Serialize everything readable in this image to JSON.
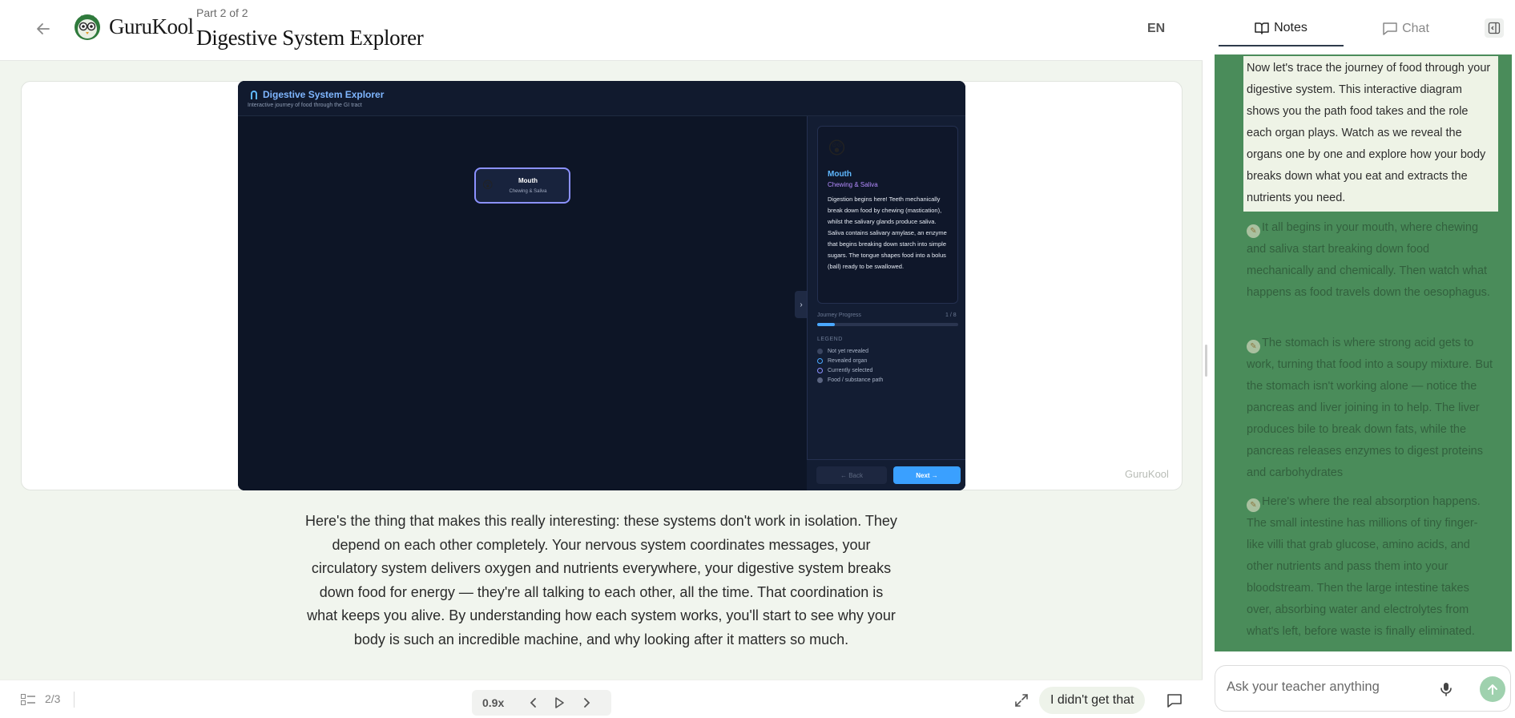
{
  "header": {
    "brand": "GuruKool",
    "part_label": "Part 2 of 2",
    "title": "Digestive System Explorer",
    "language": "EN"
  },
  "simulation": {
    "title": "Digestive System Explorer",
    "subtitle": "Interactive journey of food through the GI tract",
    "node": {
      "emoji": "😲",
      "name": "Mouth",
      "role": "Chewing & Saliva"
    },
    "info": {
      "emoji": "😲",
      "name": "Mouth",
      "role": "Chewing & Saliva",
      "description": "Digestion begins here! Teeth mechanically break down food by chewing (mastication), whilst the salivary glands produce saliva. Saliva contains salivary amylase, an enzyme that begins breaking down starch into simple sugars. The tongue shapes food into a bolus (ball) ready to be swallowed."
    },
    "progress": {
      "label": "Journey Progress",
      "count": "1 / 8",
      "fraction": 0.125
    },
    "legend": {
      "title": "LEGEND",
      "items": [
        {
          "label": "Not yet revealed",
          "color": "#3a4560"
        },
        {
          "label": "Revealed organ",
          "color": "#4aa8ff"
        },
        {
          "label": "Currently selected",
          "color": "#8b91ff"
        },
        {
          "label": "Food / substance path",
          "color": "#5a6480"
        }
      ]
    },
    "back_label": "← Back",
    "next_label": "Next →",
    "collapse_glyph": "›"
  },
  "watermark": "GuruKool",
  "transcript": "Here's the thing that makes this really interesting: these systems don't work in isolation. They depend on each other completely. Your nervous system coordinates messages, your circulatory system delivers oxygen and nutrients everywhere, your digestive system breaks down food for energy — they're all talking to each other, all the time. That coordination is what keeps you alive. By understanding how each system works, you'll start to see why your body is such an incredible machine, and why looking after it matters so much.",
  "bottombar": {
    "page_indicator": "2/3",
    "speed": "0.9x",
    "didnt_get": "I didn't get that"
  },
  "panel": {
    "tabs": {
      "notes": "Notes",
      "chat": "Chat"
    },
    "notes": [
      "Now let's trace the journey of food through your digestive system. This interactive diagram shows you the path food takes and the role each organ plays. Watch as we reveal the organs one by one and explore how your body breaks down what you eat and extracts the nutrients you need.",
      "It all begins in your mouth, where chewing and saliva start breaking down food mechanically and chemically. Then watch what happens as food travels down the oesophagus.",
      "The stomach is where strong acid gets to work, turning that food into a soupy mixture. But the stomach isn't working alone — notice the pancreas and liver joining in to help. The liver produces bile to break down fats, while the pancreas releases enzymes to digest proteins and carbohydrates",
      "Here's where the real absorption happens. The small intestine has millions of tiny finger-like villi that grab glucose, amino acids, and other nutrients and pass them into your bloodstream. Then the large intestine takes over, absorbing water and electrolytes from what's left, before waste is finally eliminated."
    ],
    "ask_placeholder": "Ask your teacher anything"
  },
  "colors": {
    "accent_green": "#4a8c5a",
    "sim_bg": "#0f172a",
    "sim_accent": "#3aa0ff"
  }
}
